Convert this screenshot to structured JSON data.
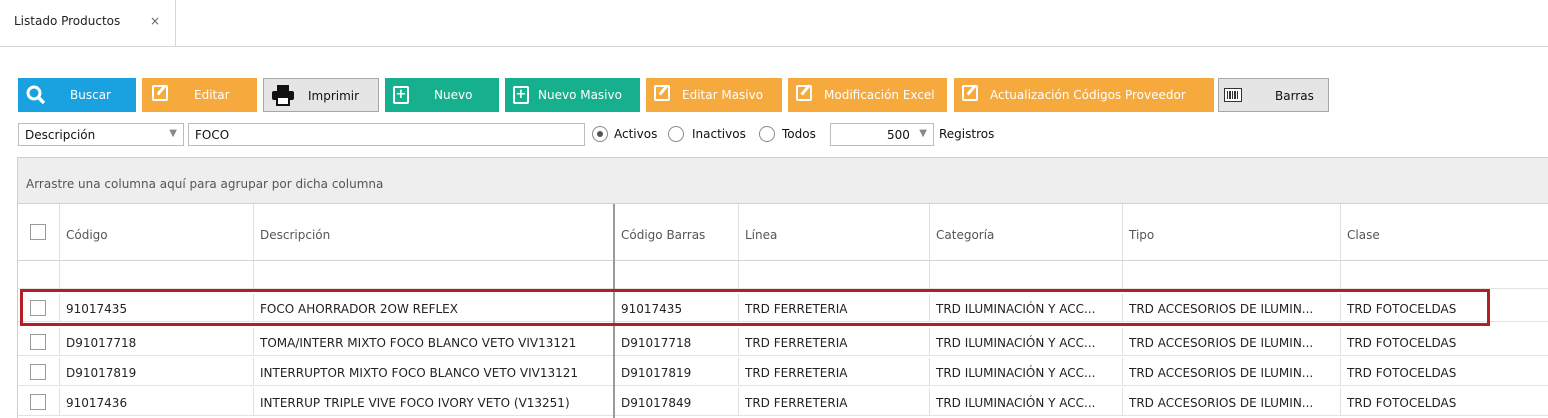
{
  "tab": {
    "title": "Listado Productos",
    "close": "×"
  },
  "toolbar": {
    "buscar": "Buscar",
    "editar": "Editar",
    "imprimir": "Imprimir",
    "nuevo": "Nuevo",
    "nuevo_masivo": "Nuevo Masivo",
    "editar_masivo": "Editar Masivo",
    "modificacion_excel": "Modificación Excel",
    "actualizacion": "Actualización Códigos Proveedor",
    "barras": "Barras"
  },
  "filter": {
    "field_select": "Descripción",
    "search_value": "FOCO",
    "status_options": [
      "Activos",
      "Inactivos",
      "Todos"
    ],
    "status_selected": "Activos",
    "records_value": "500",
    "records_label": "Registros"
  },
  "grid": {
    "group_hint": "Arrastre una columna aquí para agrupar por dicha columna",
    "columns": [
      "Código",
      "Descripción",
      "Código Barras",
      "Línea",
      "Categoría",
      "Tipo",
      "Clase"
    ],
    "rows": [
      [
        "91017435",
        "FOCO AHORRADOR 2OW REFLEX",
        "91017435",
        "TRD FERRETERIA",
        "TRD ILUMINACIÓN Y ACC...",
        "TRD ACCESORIOS DE ILUMIN...",
        "TRD FOTOCELDAS"
      ],
      [
        "D91017718",
        "TOMA/INTERR MIXTO FOCO BLANCO VETO VIV13121",
        "D91017718",
        "TRD FERRETERIA",
        "TRD ILUMINACIÓN Y ACC...",
        "TRD ACCESORIOS DE ILUMIN...",
        "TRD FOTOCELDAS"
      ],
      [
        "D91017819",
        "INTERRUPTOR MIXTO FOCO BLANCO VETO VIV13121",
        "D91017819",
        "TRD FERRETERIA",
        "TRD ILUMINACIÓN Y ACC...",
        "TRD ACCESORIOS DE ILUMIN...",
        "TRD FOTOCELDAS"
      ],
      [
        "91017436",
        "INTERRUP TRIPLE VIVE FOCO IVORY VETO (V13251)",
        "D91017849",
        "TRD FERRETERIA",
        "TRD ILUMINACIÓN Y ACC...",
        "TRD ACCESORIOS DE ILUMIN...",
        "TRD FOTOCELDAS"
      ]
    ],
    "highlighted_row": 0
  },
  "colors": {
    "blue": "#1aa1e0",
    "orange": "#f6a93d",
    "green": "#16b08f",
    "highlight": "#b31f24"
  }
}
